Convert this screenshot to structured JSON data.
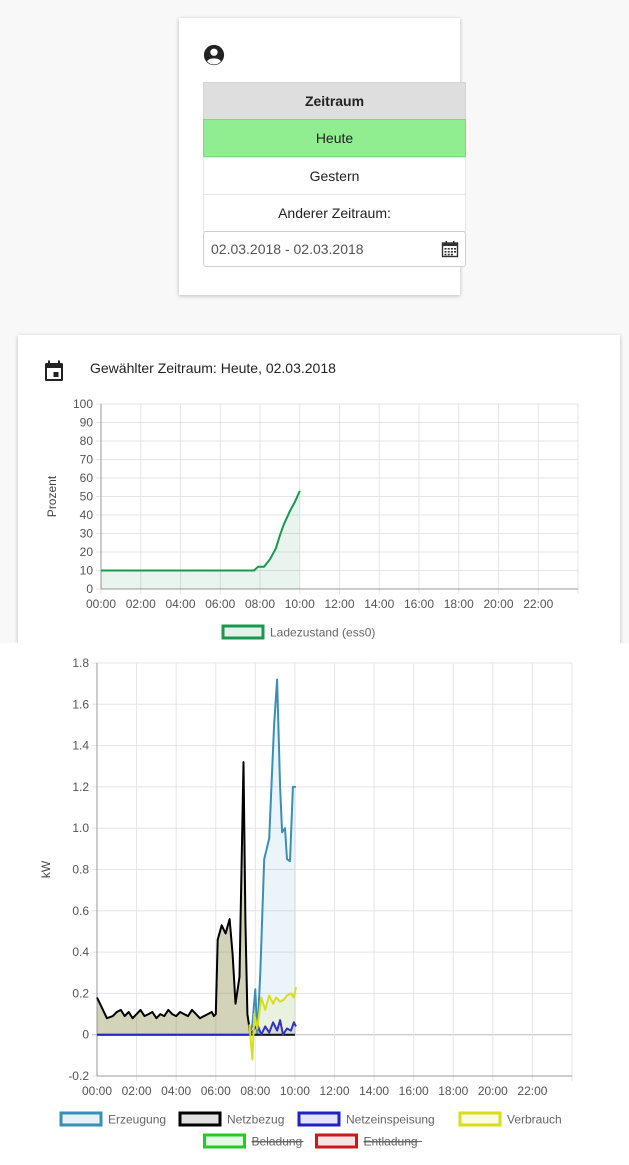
{
  "selector": {
    "header": "Zeitraum",
    "options": [
      "Heute",
      "Gestern",
      "Anderer Zeitraum:"
    ],
    "active": "Heute",
    "active_color": "#90ee90",
    "date_range": "02.03.2018 - 02.03.2018",
    "icons": {
      "user": "user-circle-icon",
      "calendar": "calendar-icon"
    }
  },
  "chart_card": {
    "period_text": "Gewählter Zeitraum: Heute, 02.03.2018",
    "icon": "calendar-today-icon"
  },
  "chart_data": [
    {
      "type": "area",
      "ylabel": "Prozent",
      "xlabel": "",
      "ylim": [
        0,
        100
      ],
      "yticks": [
        0,
        10,
        20,
        30,
        40,
        50,
        60,
        70,
        80,
        90,
        100
      ],
      "xticks": [
        "00:00",
        "02:00",
        "04:00",
        "06:00",
        "08:00",
        "10:00",
        "12:00",
        "14:00",
        "16:00",
        "18:00",
        "20:00",
        "22:00"
      ],
      "grid": true,
      "legend_position": "bottom",
      "series": [
        {
          "name": "Ladezustand (ess0)",
          "color": "#1a9850",
          "hidden": false,
          "x": [
            0,
            1,
            2,
            3,
            4,
            5,
            6,
            7,
            7.7,
            7.9,
            8.2,
            8.5,
            8.8,
            9.0,
            9.2,
            9.5,
            9.75,
            10.0
          ],
          "y": [
            10,
            10,
            10,
            10,
            10,
            10,
            10,
            10,
            10,
            12,
            12,
            16,
            22,
            29,
            35,
            42,
            47,
            53
          ]
        }
      ]
    },
    {
      "type": "area",
      "ylabel": "kW",
      "xlabel": "",
      "ylim": [
        -0.2,
        1.8
      ],
      "yticks": [
        -0.2,
        0,
        0.2,
        0.4,
        0.6,
        0.8,
        1.0,
        1.2,
        1.4,
        1.6,
        1.8
      ],
      "ytick_labels": [
        "-0.2",
        "0",
        "0.2",
        "0.4",
        "0.6",
        "0.8",
        "1.0",
        "1.2",
        "1.4",
        "1.6",
        "1.8"
      ],
      "xticks": [
        "00:00",
        "02:00",
        "04:00",
        "06:00",
        "08:00",
        "10:00",
        "12:00",
        "14:00",
        "16:00",
        "18:00",
        "20:00",
        "22:00"
      ],
      "grid": true,
      "legend_position": "bottom",
      "series": [
        {
          "name": "Erzeugung",
          "color": "#3a8fb7",
          "hidden": false,
          "x": [
            0,
            7.7,
            7.85,
            8.0,
            8.1,
            8.25,
            8.45,
            8.7,
            8.95,
            9.1,
            9.25,
            9.35,
            9.5,
            9.6,
            9.75,
            9.9,
            10.05
          ],
          "y": [
            0,
            0,
            0.05,
            0.22,
            0,
            0.3,
            0.85,
            0.95,
            1.5,
            1.72,
            1.2,
            0.98,
            1.0,
            0.85,
            0.84,
            1.2,
            1.2
          ]
        },
        {
          "name": "Netzbezug",
          "color": "#000000",
          "hidden": false,
          "x": [
            0,
            0.2,
            0.5,
            0.8,
            1.0,
            1.2,
            1.4,
            1.6,
            1.8,
            2.0,
            2.2,
            2.4,
            2.6,
            2.8,
            3.0,
            3.2,
            3.4,
            3.6,
            3.8,
            4.0,
            4.2,
            4.4,
            4.6,
            4.8,
            5.0,
            5.2,
            5.4,
            5.6,
            5.8,
            5.9,
            6.0,
            6.1,
            6.3,
            6.5,
            6.7,
            6.85,
            7.0,
            7.2,
            7.4,
            7.5,
            7.6,
            7.75,
            8.0,
            8.5,
            9.0,
            10.0
          ],
          "y": [
            0.18,
            0.14,
            0.08,
            0.09,
            0.11,
            0.12,
            0.09,
            0.11,
            0.08,
            0.1,
            0.12,
            0.09,
            0.1,
            0.11,
            0.08,
            0.1,
            0.09,
            0.12,
            0.1,
            0.09,
            0.11,
            0.1,
            0.09,
            0.12,
            0.1,
            0.08,
            0.09,
            0.1,
            0.11,
            0.09,
            0.1,
            0.46,
            0.53,
            0.49,
            0.56,
            0.39,
            0.15,
            0.28,
            1.32,
            0.55,
            0.1,
            0.0,
            0.0,
            0.0,
            0.0,
            0.0
          ]
        },
        {
          "name": "Netzeinspeisung",
          "color": "#1f22c7",
          "hidden": false,
          "x": [
            0,
            7.7,
            7.9,
            8.1,
            8.3,
            8.5,
            8.7,
            8.9,
            9.1,
            9.25,
            9.4,
            9.6,
            9.8,
            9.95,
            10.05
          ],
          "y": [
            0,
            0,
            0.02,
            0.05,
            0,
            0.04,
            0.01,
            0.06,
            0.02,
            0.07,
            0,
            0.03,
            0.02,
            0.06,
            0.04
          ]
        },
        {
          "name": "Verbrauch",
          "color": "#d9dd1c",
          "hidden": false,
          "x": [
            7.7,
            7.85,
            7.95,
            8.1,
            8.3,
            8.5,
            8.7,
            8.9,
            9.05,
            9.25,
            9.45,
            9.6,
            9.8,
            9.95,
            10.05
          ],
          "y": [
            0.05,
            -0.12,
            0.1,
            0.03,
            0.18,
            0.12,
            0.19,
            0.15,
            0.18,
            0.16,
            0.17,
            0.19,
            0.2,
            0.18,
            0.23
          ]
        },
        {
          "name": "Beladung",
          "color": "#22cc22",
          "hidden": true,
          "x": [],
          "y": []
        },
        {
          "name": "Entladung",
          "color": "#cc1a1a",
          "hidden": true,
          "x": [],
          "y": []
        }
      ]
    }
  ]
}
